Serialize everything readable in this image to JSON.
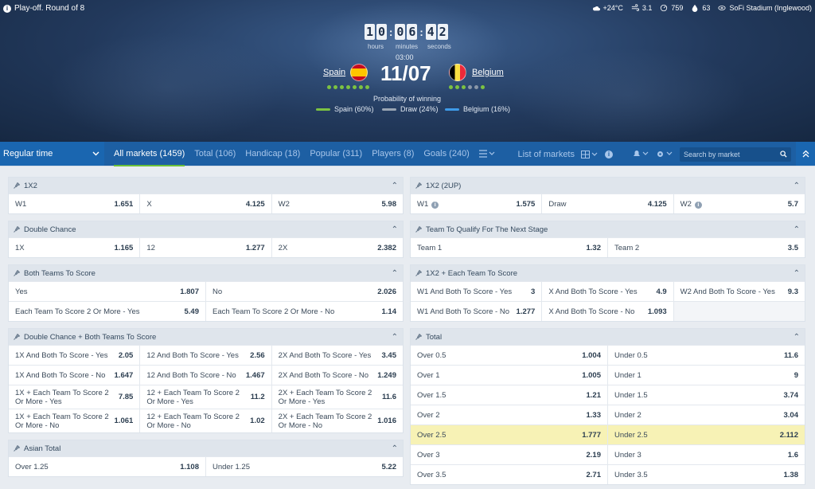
{
  "header": {
    "stage": "Play-off. Round of 8",
    "weather": "+24°C",
    "wind": "3.1",
    "pressure": "759",
    "humidity": "63",
    "stadium": "SoFi Stadium (Inglewood)",
    "timer": {
      "h1": "1",
      "h2": "0",
      "m1": "0",
      "m2": "6",
      "s1": "4",
      "s2": "2",
      "hours_label": "hours",
      "minutes_label": "minutes",
      "seconds_label": "seconds"
    },
    "time_sub": "03:00",
    "home": "Spain",
    "away": "Belgium",
    "date": "11/07",
    "prob_title": "Probability of winning",
    "legend": [
      {
        "label": "Spain (60%)",
        "color": "#7cc242"
      },
      {
        "label": "Draw (24%)",
        "color": "#9aa6b4"
      },
      {
        "label": "Belgium (16%)",
        "color": "#3e9be8"
      }
    ]
  },
  "nav": {
    "period": "Regular time",
    "tabs": [
      "All markets (1459)",
      "Total (106)",
      "Handicap (18)",
      "Popular (311)",
      "Players (8)",
      "Goals (240)"
    ],
    "list_of_markets": "List of markets",
    "search_placeholder": "Search by market"
  },
  "left": [
    {
      "title": "1X2",
      "rows": [
        [
          {
            "l": "W1",
            "o": "1.651"
          },
          {
            "l": "X",
            "o": "4.125"
          },
          {
            "l": "W2",
            "o": "5.98"
          }
        ]
      ]
    },
    {
      "title": "Double Chance",
      "rows": [
        [
          {
            "l": "1X",
            "o": "1.165"
          },
          {
            "l": "12",
            "o": "1.277"
          },
          {
            "l": "2X",
            "o": "2.382"
          }
        ]
      ]
    },
    {
      "title": "Both Teams To Score",
      "rows": [
        [
          {
            "l": "Yes",
            "o": "1.807"
          },
          {
            "l": "No",
            "o": "2.026"
          }
        ],
        [
          {
            "l": "Each Team To Score 2 Or More - Yes",
            "o": "5.49"
          },
          {
            "l": "Each Team To Score 2 Or More - No",
            "o": "1.14"
          }
        ]
      ]
    },
    {
      "title": "Double Chance + Both Teams To Score",
      "rows": [
        [
          {
            "l": "1X And Both To Score - Yes",
            "o": "2.05"
          },
          {
            "l": "12 And Both To Score - Yes",
            "o": "2.56"
          },
          {
            "l": "2X And Both To Score - Yes",
            "o": "3.45"
          }
        ],
        [
          {
            "l": "1X And Both To Score - No",
            "o": "1.647"
          },
          {
            "l": "12 And Both To Score - No",
            "o": "1.467"
          },
          {
            "l": "2X And Both To Score - No",
            "o": "1.249"
          }
        ],
        [
          {
            "l": "1X + Each Team To Score 2 Or More - Yes",
            "o": "7.85",
            "tall": true
          },
          {
            "l": "12 + Each Team To Score 2 Or More - Yes",
            "o": "11.2",
            "tall": true
          },
          {
            "l": "2X + Each Team To Score 2 Or More - Yes",
            "o": "11.6",
            "tall": true
          }
        ],
        [
          {
            "l": "1X + Each Team To Score 2 Or More - No",
            "o": "1.061",
            "tall": true
          },
          {
            "l": "12 + Each Team To Score 2 Or More - No",
            "o": "1.02",
            "tall": true
          },
          {
            "l": "2X + Each Team To Score 2 Or More - No",
            "o": "1.016",
            "tall": true
          }
        ]
      ]
    },
    {
      "title": "Asian Total",
      "rows": [
        [
          {
            "l": "Over 1.25",
            "o": "1.108"
          },
          {
            "l": "Under 1.25",
            "o": "5.22"
          }
        ]
      ]
    }
  ],
  "right": [
    {
      "title": "1X2 (2UP)",
      "rows": [
        [
          {
            "l": "W1",
            "o": "1.575",
            "info": true
          },
          {
            "l": "Draw",
            "o": "4.125"
          },
          {
            "l": "W2",
            "o": "5.7",
            "info": true
          }
        ]
      ]
    },
    {
      "title": "Team To Qualify For The Next Stage",
      "rows": [
        [
          {
            "l": "Team 1",
            "o": "1.32"
          },
          {
            "l": "Team 2",
            "o": "3.5"
          }
        ]
      ]
    },
    {
      "title": "1X2 + Each Team To Score",
      "rows": [
        [
          {
            "l": "W1 And Both To Score - Yes",
            "o": "3"
          },
          {
            "l": "X And Both To Score - Yes",
            "o": "4.9"
          },
          {
            "l": "W2 And Both To Score - Yes",
            "o": "9.3"
          }
        ],
        [
          {
            "l": "W1 And Both To Score - No",
            "o": "1.277"
          },
          {
            "l": "X And Both To Score - No",
            "o": "1.093"
          },
          {
            "l": "",
            "o": "",
            "empty": true
          }
        ]
      ]
    },
    {
      "title": "Total",
      "rows": [
        [
          {
            "l": "Over 0.5",
            "o": "1.004"
          },
          {
            "l": "Under 0.5",
            "o": "11.6"
          }
        ],
        [
          {
            "l": "Over 1",
            "o": "1.005"
          },
          {
            "l": "Under 1",
            "o": "9"
          }
        ],
        [
          {
            "l": "Over 1.5",
            "o": "1.21"
          },
          {
            "l": "Under 1.5",
            "o": "3.74"
          }
        ],
        [
          {
            "l": "Over 2",
            "o": "1.33"
          },
          {
            "l": "Under 2",
            "o": "3.04"
          }
        ],
        [
          {
            "l": "Over 2.5",
            "o": "1.777",
            "hl": true
          },
          {
            "l": "Under 2.5",
            "o": "2.112",
            "hl": true
          }
        ],
        [
          {
            "l": "Over 3",
            "o": "2.19"
          },
          {
            "l": "Under 3",
            "o": "1.6"
          }
        ],
        [
          {
            "l": "Over 3.5",
            "o": "2.71"
          },
          {
            "l": "Under 3.5",
            "o": "1.38"
          }
        ]
      ]
    }
  ]
}
